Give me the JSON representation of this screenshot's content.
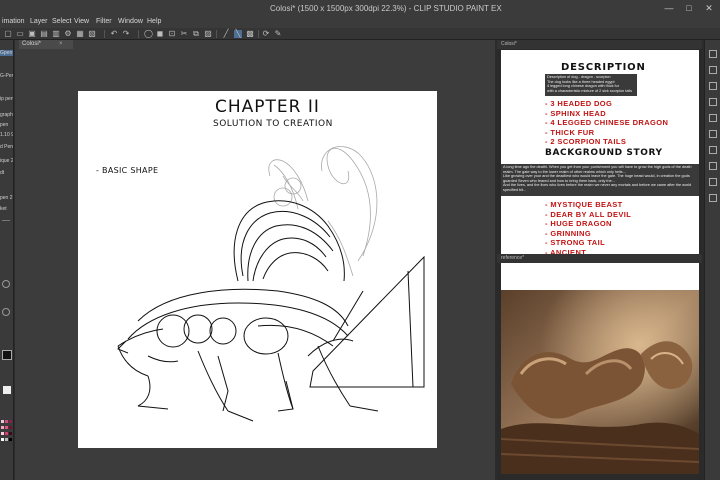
{
  "window": {
    "title": "Colosi* (1500 x 1500px 300dpi 22.3%) - CLIP STUDIO PAINT EX",
    "controls": [
      "—",
      "□",
      "✕"
    ]
  },
  "menu": [
    "imation",
    "Layer",
    "Select",
    "View",
    "Filter",
    "Window",
    "Help"
  ],
  "canvas_tab": {
    "label": "Colosi*"
  },
  "left_tools": [
    "Gpen",
    "G-Pen",
    "ip pen",
    "graphy",
    "pen",
    "1.10 9",
    "d Pen",
    "ique 2",
    "dt",
    "pen 2",
    "ket"
  ],
  "sketch": {
    "title": "CHAPTER II",
    "subtitle": "SOLUTION TO CREATION",
    "note": "- BASIC SHAPE"
  },
  "description_panel": {
    "tab_label": "Colosi*",
    "heading": "DESCRIPTION",
    "dark_text": "Description of dog - dragon - scorpion\nThe dog looks like a three headed egypt\n4 legged long chinese dragon with thick fur\nwith a characteristic mixture of 2 sick scorpion tails",
    "traits": [
      "- 3 HEADED DOG",
      "- SPHINX HEAD",
      "- 4 LEGGED CHINESE DRAGON",
      "- THICK FUR",
      "- 2 SCORPION TAILS"
    ],
    "background_heading": "BACKGROUND STORY",
    "story_text": "A long time ago the deathi. When you get from your punishment you will have to grow the high gods of the death realm. The gate way to the lower realm of other realms which only hells...\nLike growing over your and the deadliest who would leave the gate. The huge beast would, in creation the gods guarded Seven who feared and how to bring them back, only the...\nAnd the lives, and the lives who lives before the realm we never any mortals and before we came after the world specified bit...",
    "story_traits": [
      "- MYSTIQUE BEAST",
      "- DEAR BY ALL DEVIL",
      "- HUGE DRAGON",
      "- GRINNING",
      "- STRONG TAIL",
      "- ANCIENT"
    ]
  },
  "reference_panel": {
    "tab_label": "reference*"
  },
  "colors": {
    "ui_dark": "#2b2b2b",
    "panel": "#3a3a3a",
    "red_ink": "#c21414",
    "paper": "#ffffff"
  }
}
